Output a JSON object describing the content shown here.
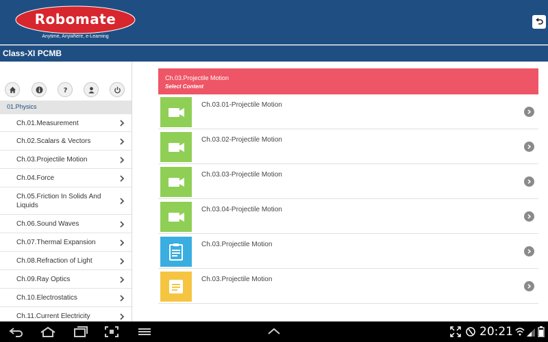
{
  "brand": {
    "logo_text": "Robomate",
    "tagline": "Anytime, Anywhere, e-Learning",
    "primary_color": "#1f4f82",
    "logo_color": "#d7262e"
  },
  "title_bar": {
    "title": "Class-XI PCMB"
  },
  "sidebar": {
    "icons": [
      "home-icon",
      "info-icon",
      "help-icon",
      "user-icon",
      "power-icon"
    ],
    "section": "01.Physics",
    "chapters": [
      "Ch.01.Measurement",
      "Ch.02.Scalars & Vectors",
      "Ch.03.Projectile Motion",
      "Ch.04.Force",
      "Ch.05.Friction In Solids And Liquids",
      "Ch.06.Sound Waves",
      "Ch.07.Thermal Expansion",
      "Ch.08.Refraction of Light",
      "Ch.09.Ray Optics",
      "Ch.10.Electrostatics",
      "Ch.11.Current Electricity"
    ]
  },
  "content": {
    "header_title": "Ch.03.Projectile Motion",
    "header_subtitle": "Select Content",
    "header_color": "#ee5566",
    "items": [
      {
        "label": "Ch.03.01-Projectile Motion",
        "icon": "video-icon",
        "color": "#8fcf55"
      },
      {
        "label": "Ch.03.02-Projectile Motion",
        "icon": "video-icon",
        "color": "#8fcf55"
      },
      {
        "label": "Ch.03.03-Projectile Motion",
        "icon": "video-icon",
        "color": "#8fcf55"
      },
      {
        "label": "Ch.03.04-Projectile Motion",
        "icon": "video-icon",
        "color": "#8fcf55"
      },
      {
        "label": "Ch.03.Projectile Motion",
        "icon": "clipboard-icon",
        "color": "#3aaee0"
      },
      {
        "label": "Ch.03.Projectile Motion",
        "icon": "notepad-icon",
        "color": "#f5c542"
      }
    ]
  },
  "system_bar": {
    "time": "20:21"
  }
}
